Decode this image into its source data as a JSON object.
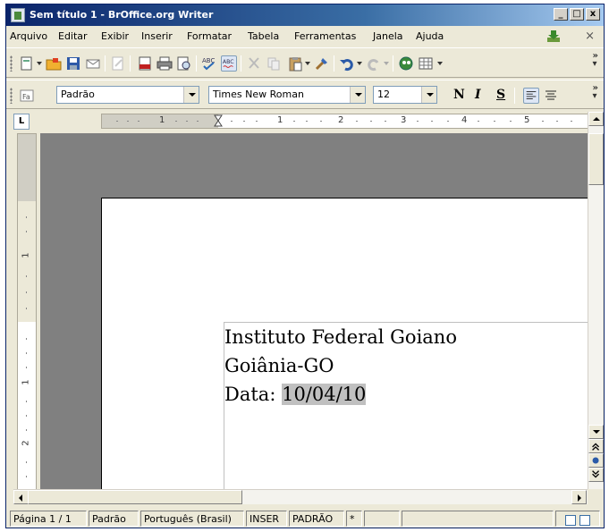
{
  "window": {
    "title": "Sem título 1 - BrOffice.org Writer",
    "controls": [
      "_",
      "□",
      "x"
    ]
  },
  "menu": {
    "items": [
      "Arquivo",
      "Editar",
      "Exibir",
      "Inserir",
      "Formatar",
      "Tabela",
      "Ferramentas",
      "Janela",
      "Ajuda"
    ],
    "close_document": "×"
  },
  "toolbar_standard": {
    "icons": [
      "new-document-icon",
      "open-folder-icon",
      "save-icon",
      "email-icon",
      "edit-file-icon",
      "export-pdf-icon",
      "print-icon",
      "page-preview-icon",
      "spellcheck-icon",
      "autospellcheck-icon",
      "cut-icon",
      "copy-icon",
      "paste-icon",
      "clone-format-icon",
      "undo-icon",
      "redo-icon",
      "navigator-icon",
      "table-icon"
    ]
  },
  "toolbar_format": {
    "style": "Padrão",
    "font": "Times New Roman",
    "size": "12",
    "bold": "N",
    "italic": "I",
    "underline": "S"
  },
  "ruler": {
    "corner": "L",
    "h_labels": [
      "1",
      "1",
      "2",
      "3",
      "4",
      "5"
    ],
    "v_labels": [
      "1",
      "1",
      "2"
    ]
  },
  "document": {
    "lines": [
      "Instituto Federal Goiano",
      "Goiânia-GO",
      "Data: "
    ],
    "selected_text": "10/04/10"
  },
  "status": {
    "page": "Página 1 / 1",
    "style": "Padrão",
    "language": "Português (Brasil)",
    "insert_mode": "INSER",
    "selection_mode": "PADRÃO",
    "modified": "*"
  },
  "colors": {
    "titlebar_start": "#0a246a",
    "titlebar_end": "#a6caf0",
    "chrome": "#ece9d8",
    "doc_background": "#808080",
    "selection": "#c0c0c0"
  }
}
